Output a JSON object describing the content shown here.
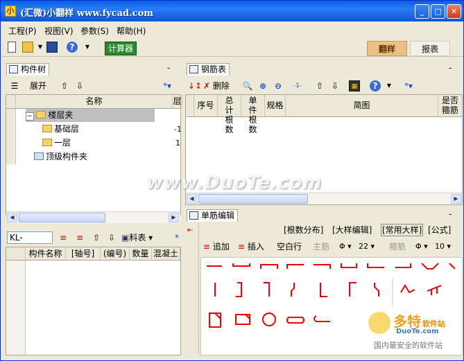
{
  "window": {
    "title": "(汇微)小翻样  www.fycad.com",
    "app_icon": "小"
  },
  "menu": [
    "工程(P)",
    "视图(V)",
    "参数(S)",
    "帮助(H)"
  ],
  "toolbar": {
    "calc": "计算器",
    "tab_fanyang": "翻样",
    "tab_baobiao": "报表"
  },
  "tree_panel": {
    "tab": "构件树",
    "expand": "展开",
    "col_name": "名称",
    "col_layer": "层",
    "items": [
      {
        "label": "楼层夹",
        "val": ""
      },
      {
        "label": "基础层",
        "val": "-1"
      },
      {
        "label": "一层",
        "val": "1"
      },
      {
        "label": "顶级构件夹",
        "val": ""
      }
    ]
  },
  "lower_left": {
    "input_value": "KL-",
    "materials": "料表",
    "cols": [
      "构件名称",
      "[轴号]",
      "(编号)",
      "数量",
      "混凝土"
    ]
  },
  "rebar_panel": {
    "tab": "钢筋表",
    "delete": "删除",
    "cols": [
      "序号",
      "总计根数",
      "单件根数",
      "规格",
      "简图",
      "是否箍筋"
    ]
  },
  "single_panel": {
    "tab": "单筋编辑",
    "links": [
      "[根数分布]",
      "[大样编辑]",
      "[常用大样]",
      "[公式]"
    ],
    "add": "追加",
    "insert": "插入",
    "blank": "空白行",
    "main": "主筋",
    "main_size": "22",
    "stirrup": "箍筋",
    "stirrup_size": "10"
  },
  "watermark": {
    "text": "www.DuoTe.com",
    "logo": "多特",
    "logo_sub": "软件站",
    "logo_url": "DuoTe.com",
    "logo_tag": "国内最安全的软件站"
  }
}
